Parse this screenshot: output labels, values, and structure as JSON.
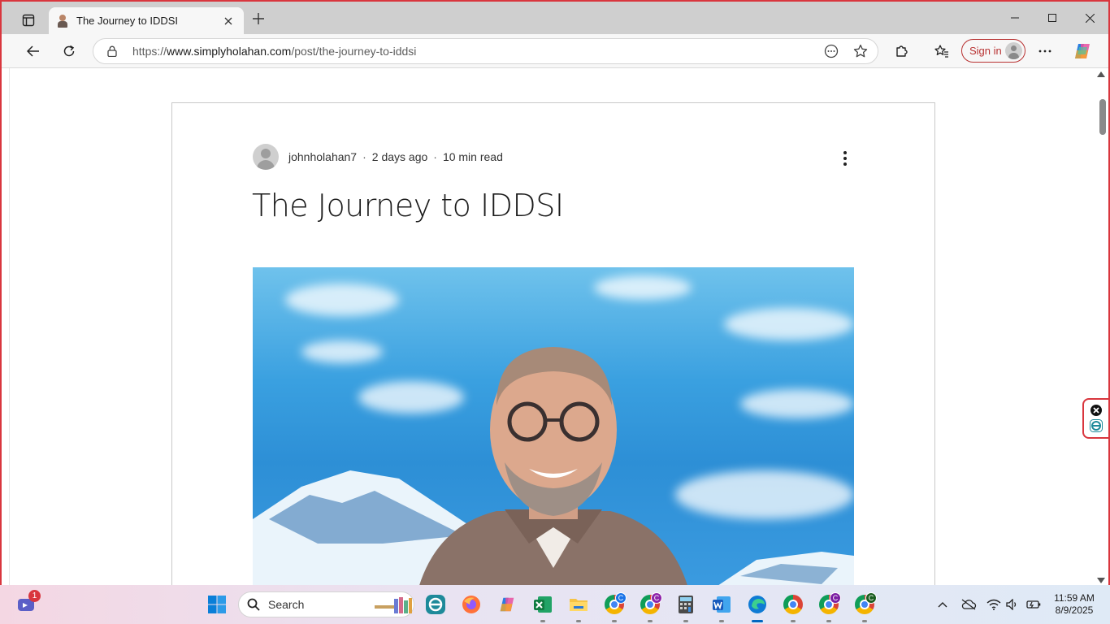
{
  "browser": {
    "tab": {
      "title": "The Journey to IDDSI"
    },
    "url": {
      "prefix": "https://",
      "host": "www.simplyholahan.com",
      "path": "/post/the-journey-to-iddsi"
    },
    "signin_label": "Sign in",
    "icons": {
      "tab_actions": "tab-actions-icon",
      "new_tab": "plus-icon",
      "back": "back-arrow-icon",
      "refresh": "refresh-icon",
      "lock": "lock-icon",
      "reader": "more-circle-icon",
      "favorite": "star-icon",
      "extensions": "puzzle-icon",
      "favorites": "favorites-icon",
      "menu": "ellipsis-icon",
      "copilot": "copilot-icon"
    }
  },
  "post": {
    "author": "johnholahan7",
    "date": "2 days ago",
    "read_time": "10 min read",
    "title": "The Journey to IDDSI"
  },
  "taskbar": {
    "search_label": "Search",
    "time": "11:59 AM",
    "date": "8/9/2025",
    "notification_count": "1",
    "chrome_profiles": [
      "C",
      "C",
      "C",
      "C"
    ],
    "colors": {
      "accent": "#0067c0",
      "badge": "#d9363e"
    }
  }
}
